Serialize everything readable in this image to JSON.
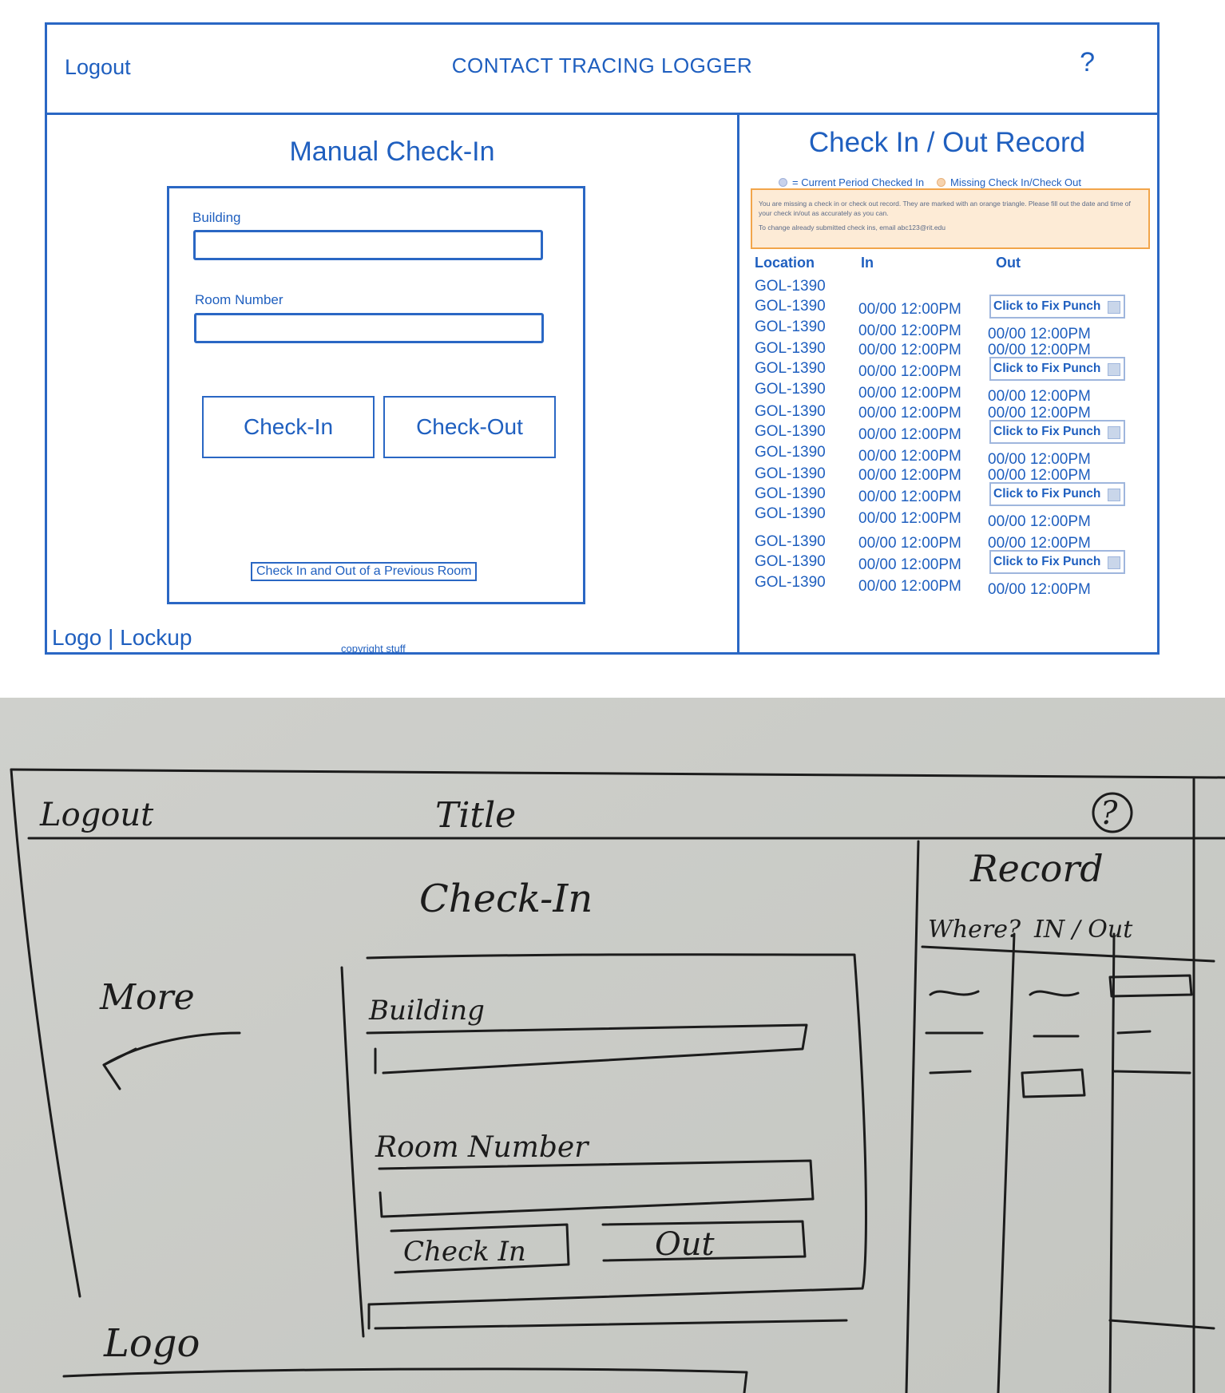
{
  "header": {
    "logout": "Logout",
    "title": "CONTACT TRACING LOGGER",
    "help": "?"
  },
  "form": {
    "title": "Manual Check-In",
    "building_label": "Building",
    "room_label": "Room Number",
    "checkin": "Check-In",
    "checkout": "Check-Out",
    "previous": "Check In and Out of a Previous Room"
  },
  "footer": {
    "logo": "Logo | Lockup",
    "copyright": "copyright stuff"
  },
  "record": {
    "title": "Check In / Out Record",
    "legend_current": "= Current Period Checked In",
    "legend_missing": "Missing Check In/Check Out",
    "colors": {
      "current": "#c8d2ec",
      "missing": "#f7d3ae"
    },
    "alert_1": "You are missing a check in or check out record. They are marked with an orange triangle. Please fill out the date and time of your check in/out as accurately as you can.",
    "alert_2": "To change already submitted check ins, email abc123@rit.edu",
    "headers": [
      "Location",
      "In",
      "Out"
    ],
    "locations": [
      "GOL-1390",
      "GOL-1390",
      "GOL-1390",
      "GOL-1390",
      "GOL-1390",
      "GOL-1390",
      "GOL-1390",
      "GOL-1390",
      "GOL-1390",
      "GOL-1390",
      "GOL-1390",
      "GOL-1390",
      "GOL-1390",
      "GOL-1390",
      "GOL-1390"
    ],
    "in_times": [
      "00/00 12:00PM",
      "00/00 12:00PM",
      "00/00 12:00PM",
      "00/00 12:00PM",
      "00/00 12:00PM",
      "00/00 12:00PM",
      "00/00 12:00PM",
      "00/00 12:00PM",
      "00/00 12:00PM",
      "00/00 12:00PM",
      "00/00 12:00PM",
      "00/00 12:00PM",
      "00/00 12:00PM",
      "00/00 12:00PM"
    ],
    "out_entries": [
      {
        "fix": true,
        "text": "Click to Fix Punch"
      },
      {
        "fix": false,
        "text": "00/00 12:00PM"
      },
      {
        "fix": false,
        "text": "00/00 12:00PM"
      },
      {
        "fix": true,
        "text": "Click to Fix Punch"
      },
      {
        "fix": false,
        "text": "00/00 12:00PM"
      },
      {
        "fix": false,
        "text": "00/00 12:00PM"
      },
      {
        "fix": true,
        "text": "Click to Fix Punch"
      },
      {
        "fix": false,
        "text": "00/00 12:00PM"
      },
      {
        "fix": false,
        "text": "00/00 12:00PM"
      },
      {
        "fix": true,
        "text": "Click to Fix Punch"
      },
      {
        "fix": false,
        "text": "00/00 12:00PM"
      },
      {
        "fix": false,
        "text": "00/00 12:00PM"
      },
      {
        "fix": true,
        "text": "Click to Fix Punch"
      },
      {
        "fix": false,
        "text": "00/00 12:00PM"
      }
    ]
  },
  "sketch": {
    "labels": [
      "Logout",
      "Title",
      "?",
      "Check-In",
      "More",
      "Building",
      "Room Number",
      "Check In",
      "Out",
      "Record",
      "Where?",
      "IN / Out",
      "Logo"
    ]
  }
}
